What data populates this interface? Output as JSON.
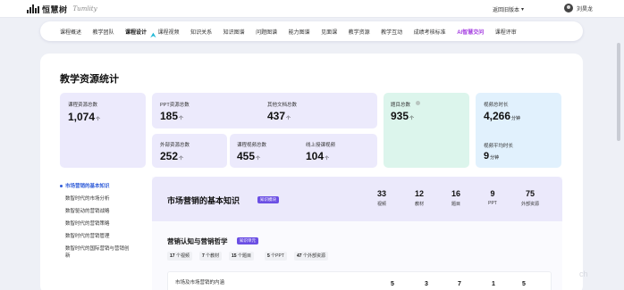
{
  "topbar": {
    "logo_text": "恒慧树",
    "logo_script": "Tumlity",
    "version_label": "返回旧版本",
    "version_icon": "chevron-down-icon",
    "user_name": "刘昊龙"
  },
  "nav": {
    "items": [
      {
        "label": "课程概述"
      },
      {
        "label": "教学团队"
      },
      {
        "label": "课程设计"
      },
      {
        "label": "课程视频"
      },
      {
        "label": "知识关系"
      },
      {
        "label": "知识图谱"
      },
      {
        "label": "问题图谱"
      },
      {
        "label": "能力图谱"
      },
      {
        "label": "见面课"
      },
      {
        "label": "教学资源"
      },
      {
        "label": "教学互动"
      },
      {
        "label": "成绩考核标准"
      },
      {
        "label": "AI智慧交问"
      },
      {
        "label": "课程评审"
      }
    ],
    "active_index": 2,
    "accent_color": "#a33be0"
  },
  "stats": {
    "title": "教学资源统计",
    "course_total": {
      "label": "课程资源总数",
      "value": "1,074",
      "unit": "个"
    },
    "ppt_total": {
      "label": "PPT资源总数",
      "value": "185",
      "unit": "个"
    },
    "other_docs": {
      "label": "其他文档总数",
      "value": "437",
      "unit": "个"
    },
    "external": {
      "label": "外部资源总数",
      "value": "252",
      "unit": "个"
    },
    "videos": {
      "label": "课程视频总数",
      "value": "455",
      "unit": "个"
    },
    "online_videos": {
      "label": "线上授课视频",
      "value": "104",
      "unit": "个"
    },
    "questions": {
      "label": "题目总数",
      "value": "935",
      "unit": "个"
    },
    "duration": {
      "label": "视频总时长",
      "value": "4,266",
      "unit": "分钟"
    },
    "avg_duration": {
      "label": "视频平均时长",
      "value": "9",
      "unit": "分钟"
    }
  },
  "side_menu": {
    "items": [
      {
        "label": "市场营销的基本知识"
      },
      {
        "label": "数智时代的市场分析"
      },
      {
        "label": "数智驱动的营销战略"
      },
      {
        "label": "数智时代的营销策略"
      },
      {
        "label": "数智时代的营销管理"
      },
      {
        "label": "数智时代的国际营销与营销创新"
      }
    ],
    "active_index": 0,
    "active_color": "#2e5bd8"
  },
  "detail": {
    "title": "市场营销的基本知识",
    "tag": "知识模块",
    "header_stats": [
      {
        "num": "33",
        "label": "视频"
      },
      {
        "num": "12",
        "label": "教材"
      },
      {
        "num": "16",
        "label": "题目"
      },
      {
        "num": "9",
        "label": "PPT"
      },
      {
        "num": "75",
        "label": "外部资源"
      }
    ],
    "sub_title": "营销认知与营销哲学",
    "sub_tag": "知识单元",
    "pills": [
      {
        "num": "17",
        "label": "个视频"
      },
      {
        "num": "7",
        "label": "个教材"
      },
      {
        "num": "15",
        "label": "个题目"
      },
      {
        "num": "5",
        "label": "个PPT"
      },
      {
        "num": "47",
        "label": "个外部资源"
      }
    ],
    "row": {
      "label": "市场及市场营销的内涵",
      "values": [
        "5",
        "3",
        "7",
        "1",
        "5"
      ]
    }
  },
  "watermark": "ch"
}
